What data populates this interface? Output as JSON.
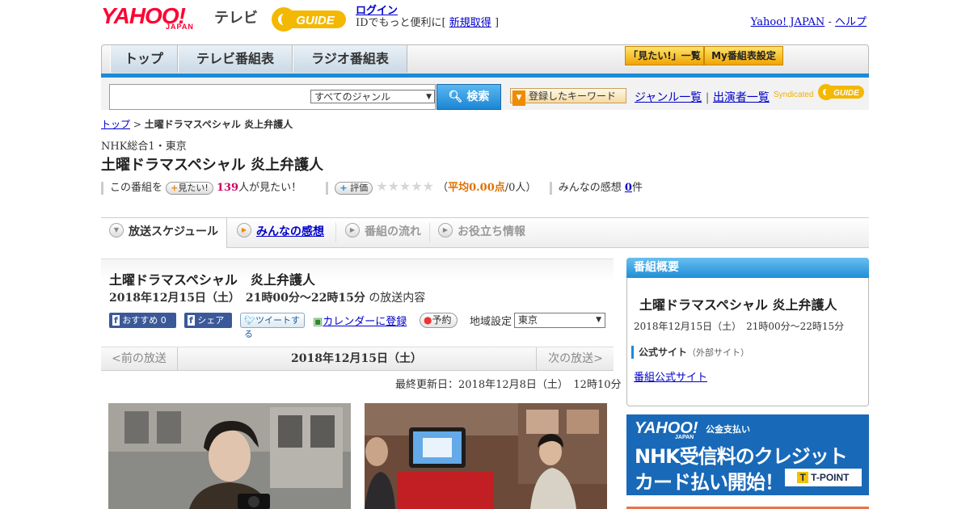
{
  "header": {
    "logo_yahoo": "YAHOO!",
    "logo_japan": "JAPAN",
    "tv_label": "テレビ",
    "gguide_label": "GUIDE",
    "login_link": "ログイン",
    "login_text": "IDでもっと便利に[",
    "signup_link": "新規取得",
    "signup_close": "]",
    "yahoo_japan_link": "Yahoo! JAPAN",
    "separator": "-",
    "help_link": "ヘルプ"
  },
  "nav": {
    "tabs": [
      {
        "label": "トップ"
      },
      {
        "label": "テレビ番組表"
      },
      {
        "label": "ラジオ番組表"
      }
    ],
    "mitai_list": "「見たい!」一覧",
    "my_schedule": "My番組表設定"
  },
  "search": {
    "genre_selected": "すべてのジャンル",
    "button_label": "検索",
    "keyword_button": "登録したキーワード",
    "genre_list": "ジャンル一覧",
    "divider": "|",
    "cast_list": "出演者一覧",
    "syndicated": "Syndicated"
  },
  "breadcrumb": {
    "top": "トップ",
    "sep": ">",
    "current": "土曜ドラマスペシャル 炎上弁護人"
  },
  "program": {
    "station": "NHK総合1・東京",
    "title": "土曜ドラマスペシャル 炎上弁護人",
    "mitai_prefix": "この番組を",
    "mitai_btn": "見たい!",
    "mitai_count": "139",
    "mitai_suffix": "人が見たい！",
    "rate_btn": "評価",
    "stars": [
      "★",
      "★",
      "★",
      "★",
      "★"
    ],
    "avg_open": "（",
    "avg_label": "平均0.00点",
    "avg_people": "/0人",
    "avg_close": "）",
    "impressions_label": "みんなの感想",
    "impressions_count": "0",
    "impressions_unit": "件"
  },
  "subtabs": [
    {
      "label": "放送スケジュール"
    },
    {
      "label": "みんなの感想"
    },
    {
      "label": "番組の流れ"
    },
    {
      "label": "お役立ち情報"
    }
  ],
  "main": {
    "title": "土曜ドラマスペシャル　炎上弁護人",
    "date_time": "2018年12月15日（土）　21時00分～22時15分",
    "date_suffix": "の放送内容",
    "fb_recommend": "おすすめ",
    "fb_count": "0",
    "fb_share": "シェア",
    "tweet": "ツイートする",
    "calendar": "カレンダーに登録",
    "reserve": "予約",
    "region_label": "地域設定",
    "region_value": "東京",
    "prev": "<前の放送",
    "current_date": "2018年12月15日（土）",
    "next": "次の放送>",
    "updated": "最終更新日：2018年12月8日（土）　12時10分"
  },
  "sidebar": {
    "header": "番組概要",
    "title": "土曜ドラマスペシャル 炎上弁護人",
    "date_time": "2018年12月15日（土）　21時00分～22時15分",
    "official_label": "公式サイト",
    "official_note": "（外部サイト）",
    "official_link": "番組公式サイト"
  },
  "ad": {
    "yahoo": "YAHOO!",
    "japan": "JAPAN",
    "payment": "公金支払い",
    "line1": "NHK受信料のクレジット",
    "line2": "カード払い開始！",
    "tpoint": "T-POINT"
  },
  "colors": {
    "accent_blue": "#1a8bd8",
    "link": "#0000cc",
    "mitai_count": "#cc0066",
    "avg": "#e07000"
  }
}
